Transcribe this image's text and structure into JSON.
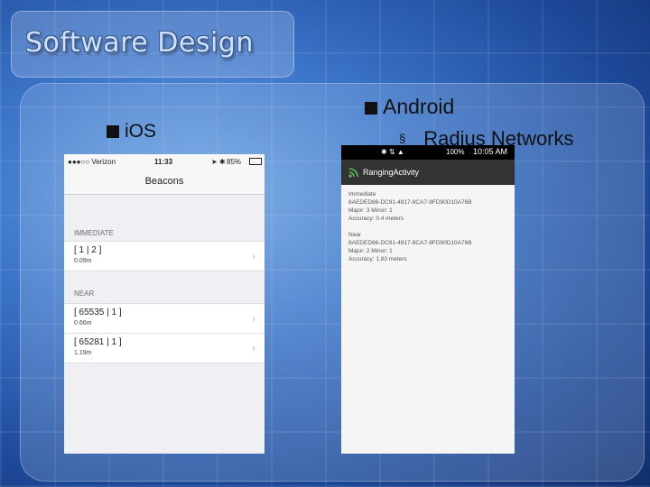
{
  "slide": {
    "title": "Software Design",
    "left_bullet": "iOS",
    "right_bullet": "Android",
    "right_subbullet_marker": "§",
    "right_subbullet": "Radius Networks"
  },
  "ios": {
    "status": {
      "carrier": "●●●○○ Verizon",
      "time": "11:33",
      "battery": "85%"
    },
    "nav_title": "Beacons",
    "sections": [
      {
        "header": "IMMEDIATE",
        "rows": [
          {
            "title": "[ 1 | 2 ]",
            "detail": "0.09m"
          }
        ]
      },
      {
        "header": "NEAR",
        "rows": [
          {
            "title": "[ 65535 | 1 ]",
            "detail": "0.66m"
          },
          {
            "title": "[ 65281 | 1 ]",
            "detail": "1.19m"
          }
        ]
      }
    ]
  },
  "android": {
    "status": {
      "time": "10:05 AM",
      "battery": "100%"
    },
    "activity_title": "RangingActivity",
    "entries": [
      {
        "label": "Immediate",
        "uuid": "8AEDED86-DC91-4917-9CA7-9FD90D10A76B",
        "major_minor": "Major: 3    Minor: 1",
        "accuracy": "Accuracy: 0.4 meters"
      },
      {
        "label": "Near",
        "uuid": "8AEDED86-DC91-4917-9CA7-9FD90D10A76B",
        "major_minor": "Major: 2    Minor: 1",
        "accuracy": "Accuracy: 1.83 meters"
      }
    ]
  },
  "colors": {
    "background": "#3b74c8",
    "title_text": "#cfe0ff",
    "android_bar": "#333333",
    "android_wifi": "#5cb85c"
  }
}
